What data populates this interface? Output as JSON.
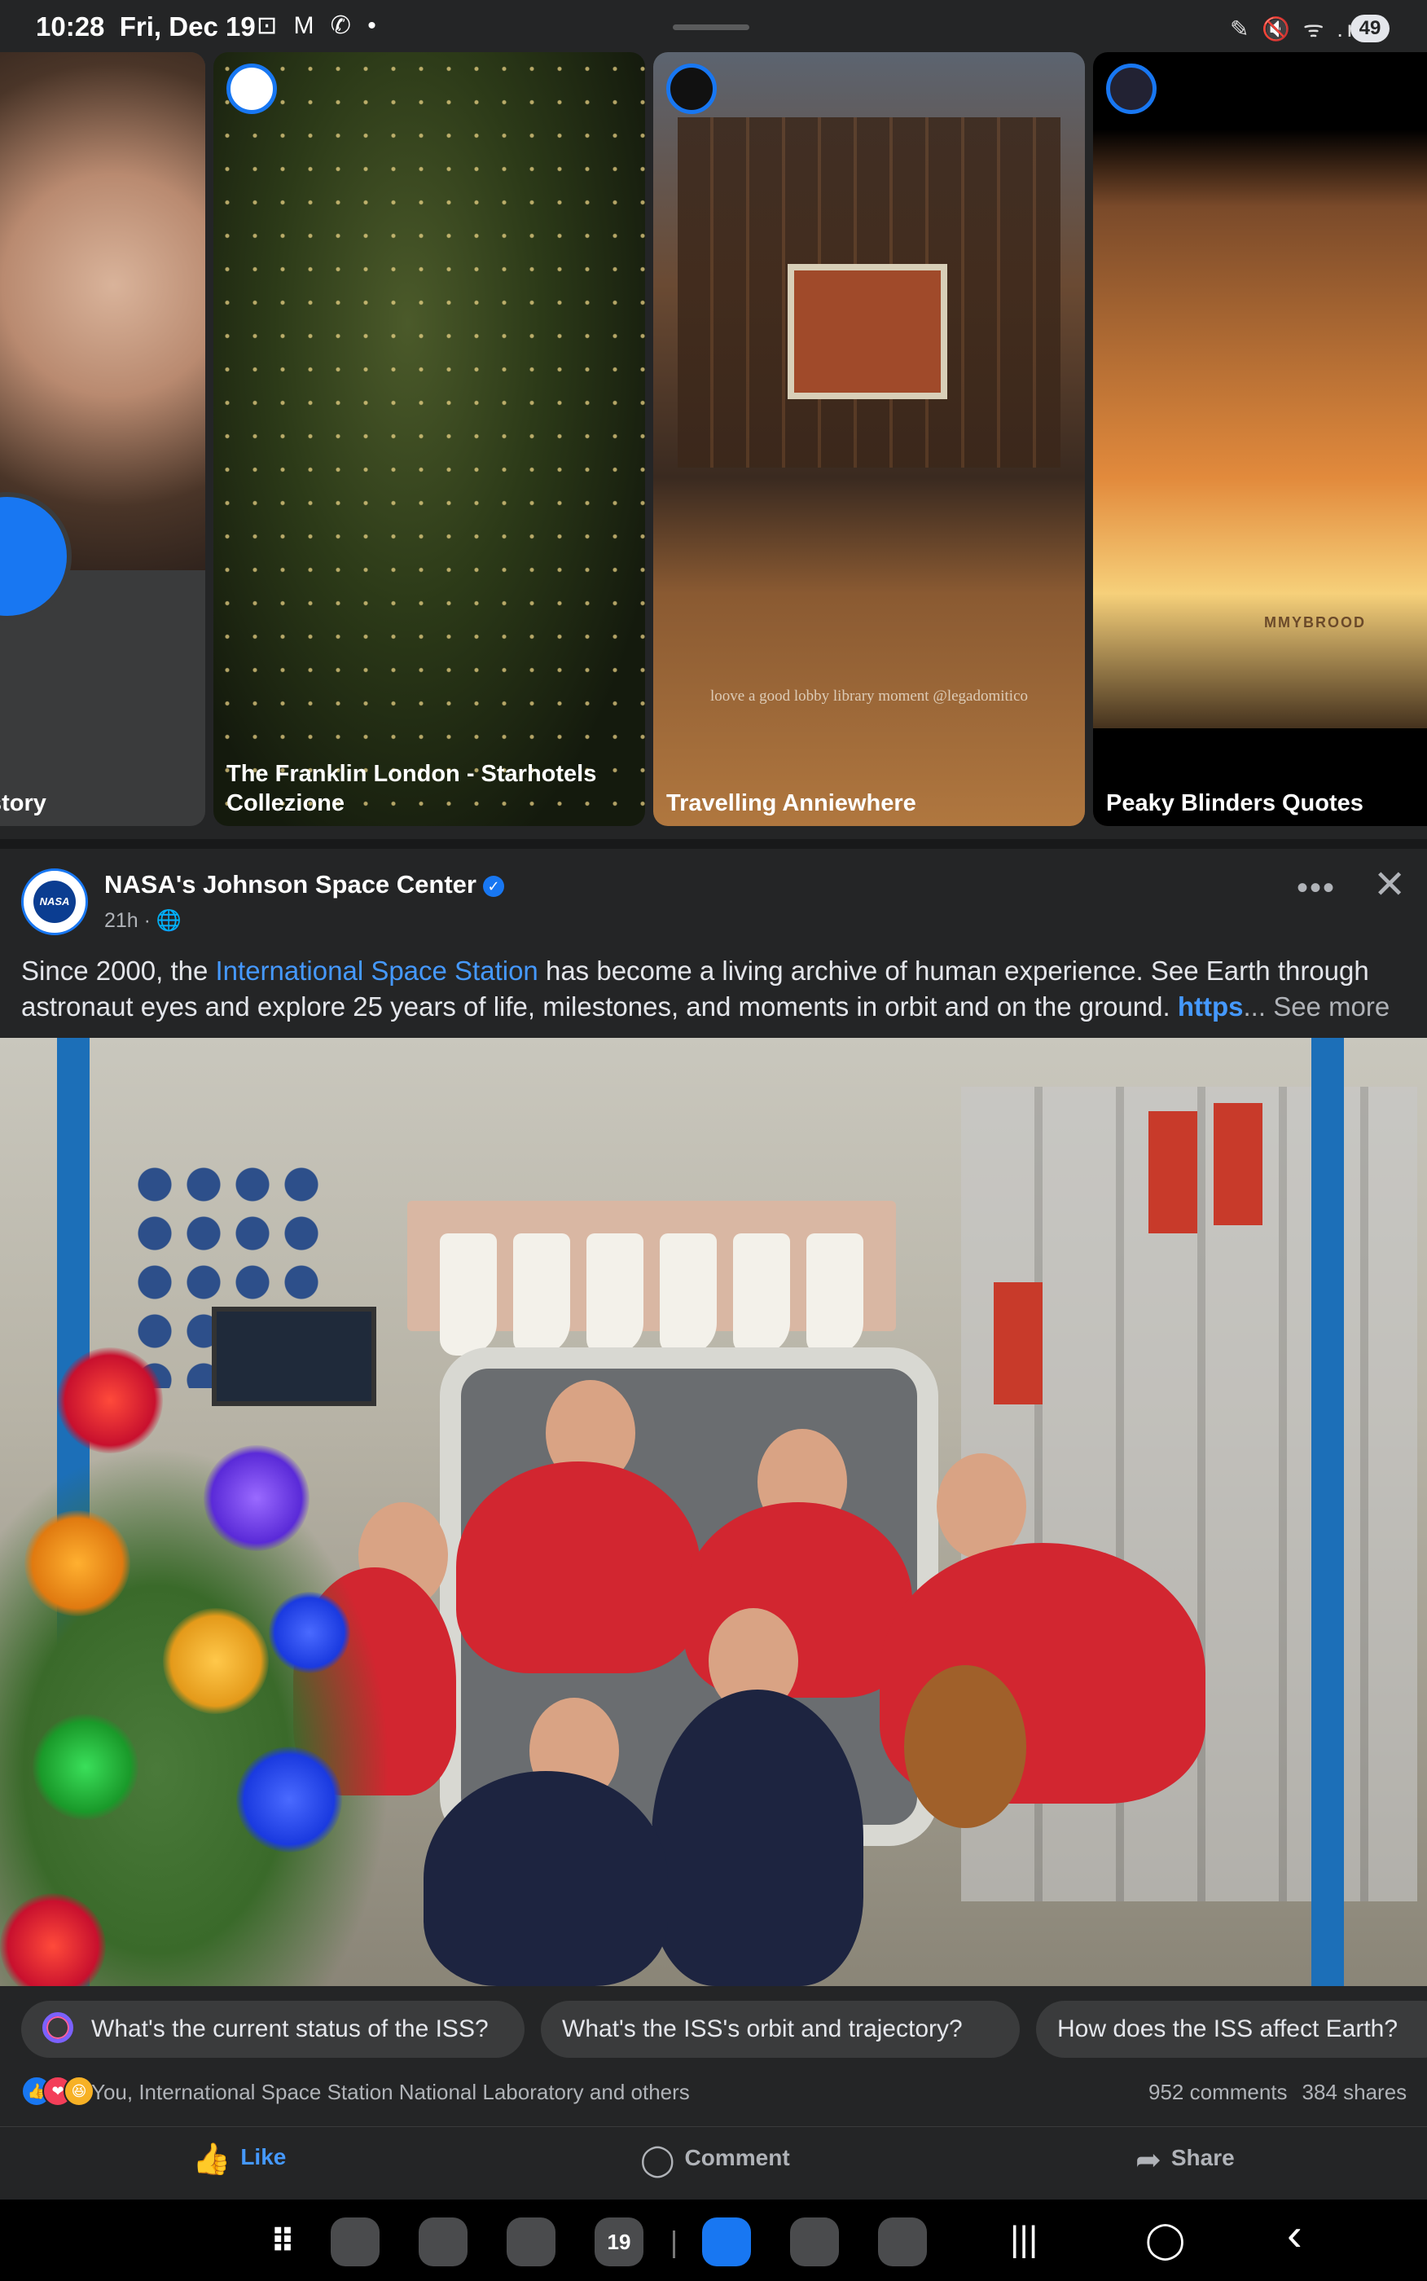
{
  "status_bar": {
    "time": "10:28",
    "date": "Fri, Dec 19",
    "left_icons": "⊡ M ✆ •",
    "right_icons": "✎ 🔇 ᯤ .ıll",
    "battery": "49"
  },
  "stories": [
    {
      "label": "story"
    },
    {
      "label": "The Franklin London - Starhotels Collezione"
    },
    {
      "label": "Travelling Anniewhere",
      "watermark": "loove a good lobby library moment @legadomitico"
    },
    {
      "label": "Peaky Blinders Quotes",
      "watermark": "MMYBROOD"
    }
  ],
  "post": {
    "author": "NASA's Johnson Space Center",
    "avatar_text": "NASA",
    "verified_icon": "✓",
    "time": "21h · 🌐",
    "more_label": "•••",
    "close_label": "✕",
    "text_part1": "Since 2000, the ",
    "text_link": "International Space Station",
    "text_part2": " has become a living archive of human experience. See Earth through astronaut eyes and explore 25 years of life, milestones, and moments in orbit and on the ground. ",
    "text_url": "https",
    "text_ellipsis": "... ",
    "see_more": "See more"
  },
  "ai_prompts": [
    "What's the current status of the ISS?",
    "What's the ISS's orbit and trajectory?",
    "How does the ISS affect Earth?"
  ],
  "reactions": {
    "icons": [
      "👍",
      "❤",
      "😆"
    ],
    "summary": "You, International Space Station National Laboratory and others",
    "comments": "952 comments",
    "shares": "384 shares"
  },
  "actions": {
    "like": "Like",
    "comment": "Comment",
    "share": "Share",
    "like_icon": "👍",
    "comment_icon": "◯",
    "share_icon": "➦"
  },
  "nav": {
    "apps_icon": "⠿",
    "calendar_day": "19",
    "recents_icon": "|||",
    "home_icon": "◯",
    "back_icon": "‹"
  },
  "colors": {
    "accent": "#1877f2",
    "link": "#4599ff",
    "background": "#242526"
  }
}
